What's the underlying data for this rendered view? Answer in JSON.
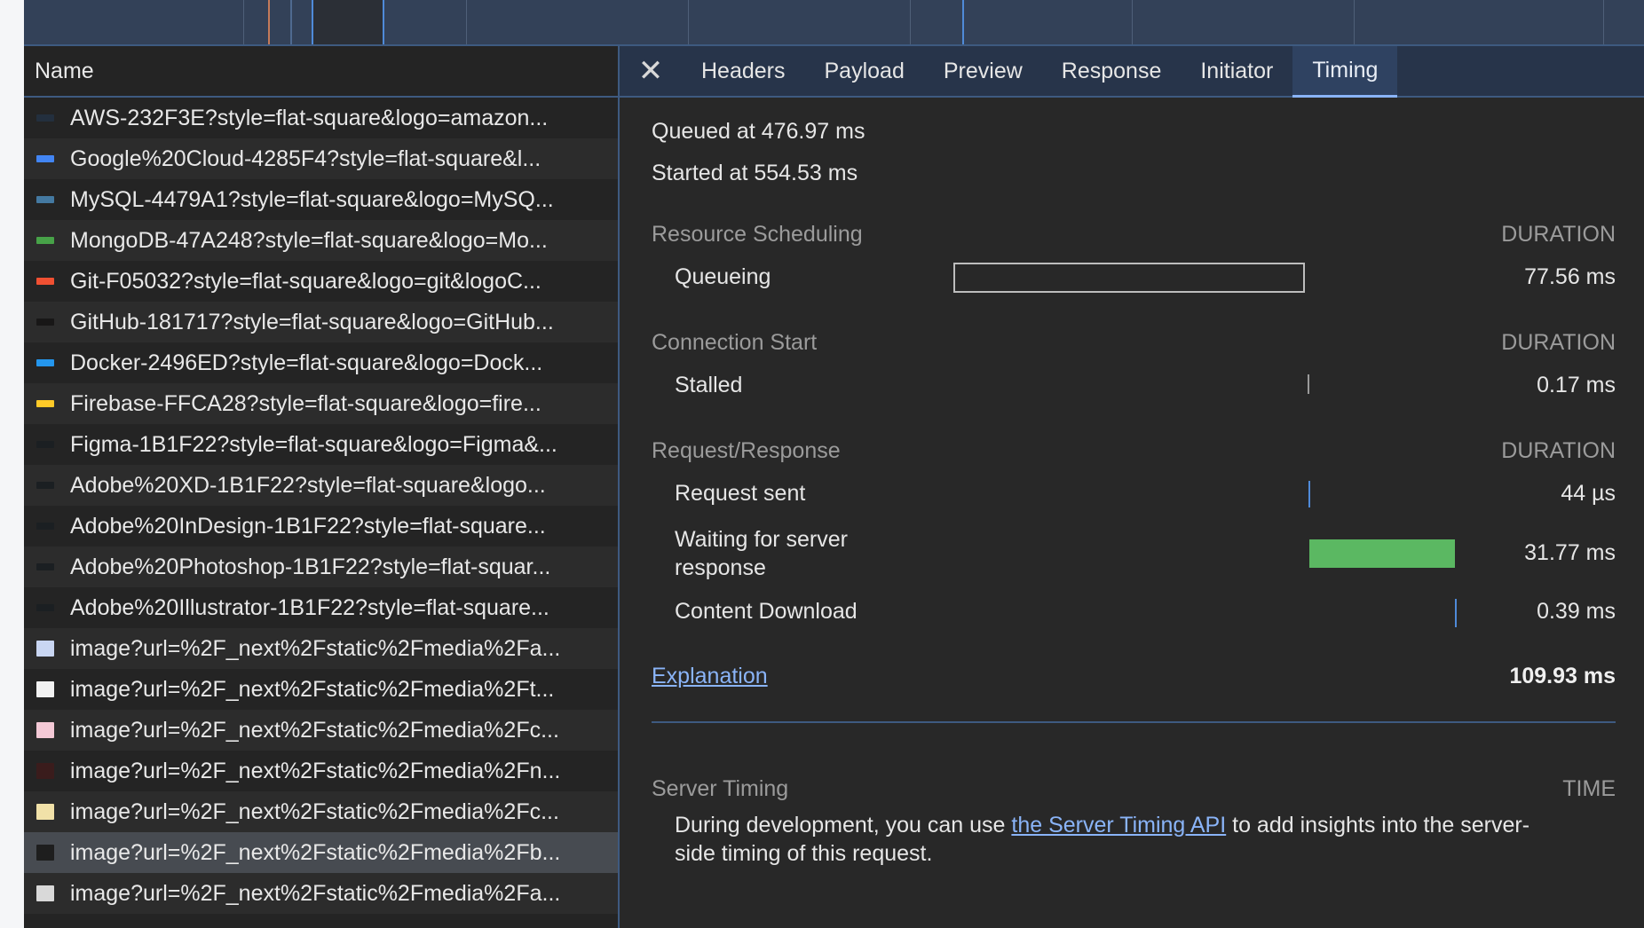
{
  "list": {
    "header": "Name",
    "rows": [
      {
        "name": "AWS-232F3E?style=flat-square&logo=amazon...",
        "color": "#232F3E",
        "selected": false
      },
      {
        "name": "Google%20Cloud-4285F4?style=flat-square&l...",
        "color": "#4285F4",
        "selected": false
      },
      {
        "name": "MySQL-4479A1?style=flat-square&logo=MySQ...",
        "color": "#4479A1",
        "selected": false
      },
      {
        "name": "MongoDB-47A248?style=flat-square&logo=Mo...",
        "color": "#47A248",
        "selected": false
      },
      {
        "name": "Git-F05032?style=flat-square&logo=git&logoC...",
        "color": "#F05032",
        "selected": false
      },
      {
        "name": "GitHub-181717?style=flat-square&logo=GitHub...",
        "color": "#181717",
        "selected": false
      },
      {
        "name": "Docker-2496ED?style=flat-square&logo=Dock...",
        "color": "#2496ED",
        "selected": false
      },
      {
        "name": "Firebase-FFCA28?style=flat-square&logo=fire...",
        "color": "#FFCA28",
        "selected": false
      },
      {
        "name": "Figma-1B1F22?style=flat-square&logo=Figma&...",
        "color": "#1B1F22",
        "selected": false
      },
      {
        "name": "Adobe%20XD-1B1F22?style=flat-square&logo...",
        "color": "#1B1F22",
        "selected": false
      },
      {
        "name": "Adobe%20InDesign-1B1F22?style=flat-square...",
        "color": "#1B1F22",
        "selected": false
      },
      {
        "name": "Adobe%20Photoshop-1B1F22?style=flat-squar...",
        "color": "#1B1F22",
        "selected": false
      },
      {
        "name": "Adobe%20Illustrator-1B1F22?style=flat-square...",
        "color": "#1B1F22",
        "selected": false
      },
      {
        "name": "image?url=%2F_next%2Fstatic%2Fmedia%2Fa...",
        "color": "#c9d6f2",
        "selected": false
      },
      {
        "name": "image?url=%2F_next%2Fstatic%2Fmedia%2Ft...",
        "color": "#f2f2f2",
        "selected": false
      },
      {
        "name": "image?url=%2F_next%2Fstatic%2Fmedia%2Fc...",
        "color": "#f4c9d6",
        "selected": false
      },
      {
        "name": "image?url=%2F_next%2Fstatic%2Fmedia%2Fn...",
        "color": "#3a1c1c",
        "selected": false
      },
      {
        "name": "image?url=%2F_next%2Fstatic%2Fmedia%2Fc...",
        "color": "#f1e1a8",
        "selected": false
      },
      {
        "name": "image?url=%2F_next%2Fstatic%2Fmedia%2Fb...",
        "color": "#1e1e1e",
        "selected": true
      },
      {
        "name": "image?url=%2F_next%2Fstatic%2Fmedia%2Fa...",
        "color": "#d9d9d9",
        "selected": false
      }
    ]
  },
  "tabs": {
    "close_label": "✕",
    "items": [
      "Headers",
      "Payload",
      "Preview",
      "Response",
      "Initiator",
      "Timing"
    ],
    "active": "Timing"
  },
  "timing": {
    "queued_at": "Queued at 476.97 ms",
    "started_at": "Started at 554.53 ms",
    "duration_label": "DURATION",
    "sections": {
      "resource_scheduling": "Resource Scheduling",
      "connection_start": "Connection Start",
      "request_response": "Request/Response"
    },
    "rows": {
      "queueing": {
        "label": "Queueing",
        "value": "77.56 ms"
      },
      "stalled": {
        "label": "Stalled",
        "value": "0.17 ms"
      },
      "request_sent": {
        "label": "Request sent",
        "value": "44 µs"
      },
      "waiting": {
        "label": "Waiting for server response",
        "value": "31.77 ms"
      },
      "content_download": {
        "label": "Content Download",
        "value": "0.39 ms"
      }
    },
    "explanation": "Explanation",
    "total": "109.93 ms",
    "server_timing": {
      "title": "Server Timing",
      "time_label": "TIME",
      "text_before": "During development, you can use ",
      "link": "the Server Timing API",
      "text_after": " to add insights into the server-side timing of this request."
    }
  },
  "colors": {
    "accent": "#8ab4f8",
    "waiting_bar": "#5bb862",
    "marker_blue": "#4f8ad8"
  }
}
